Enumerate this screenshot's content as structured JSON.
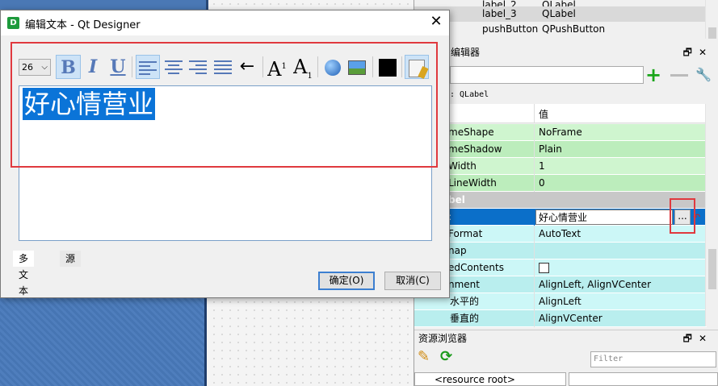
{
  "object_inspector": {
    "rows": [
      {
        "name": "label_2",
        "class": "QLabel"
      },
      {
        "name": "label_3",
        "class": "QLabel"
      },
      {
        "name": "pushButton",
        "class": "QPushButton"
      }
    ]
  },
  "property_editor": {
    "title": "编辑器",
    "class_line": ": QLabel",
    "header_value": "值",
    "rows": [
      {
        "key": "meShape",
        "value": "NoFrame",
        "style": "g1"
      },
      {
        "key": "meShadow",
        "value": "Plain",
        "style": "g2"
      },
      {
        "key": "Width",
        "value": "1",
        "style": "g1"
      },
      {
        "key": "LineWidth",
        "value": "0",
        "style": "g2"
      },
      {
        "key": "bel",
        "value": "",
        "style": "grayhdr"
      },
      {
        "key": ":",
        "value": "好心情营业",
        "style": "selrow"
      },
      {
        "key": "Format",
        "value": "AutoText",
        "style": "c1"
      },
      {
        "key": "nap",
        "value": "",
        "style": "c2"
      },
      {
        "key": "edContents",
        "value": "",
        "style": "c1"
      },
      {
        "key": "nment",
        "value": "AlignLeft, AlignVCenter",
        "style": "c2"
      },
      {
        "key": "水平的",
        "value": "AlignLeft",
        "style": "c1"
      },
      {
        "key": "垂直的",
        "value": "AlignVCenter",
        "style": "c2"
      }
    ],
    "ellipsis_button": "..."
  },
  "resource_browser": {
    "title": "资源浏览器",
    "filter_placeholder": "Filter",
    "root_item": "<resource root>"
  },
  "dialog": {
    "title": "编辑文本 - Qt Designer",
    "title_icon": "D",
    "font_size": "26",
    "toolbar": {
      "bold": "B",
      "italic": "I",
      "underline": "U",
      "superscript": "A",
      "subscript": "A",
      "sup_mark": "1",
      "sub_mark": "1",
      "arrow": "←"
    },
    "text_content": "好心情营业",
    "tabs": [
      "多文本",
      "源"
    ],
    "ok_label": "确定(O)",
    "cancel_label": "取消(C)"
  },
  "colors": {
    "highlight": "#0b74d8",
    "annotation": "#e0393e"
  }
}
